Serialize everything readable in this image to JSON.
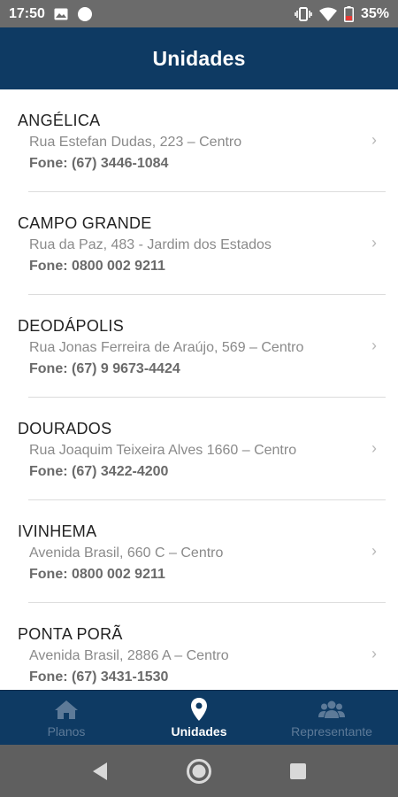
{
  "status_bar": {
    "time": "17:50",
    "battery": "35%",
    "icons": [
      "image-icon",
      "circle-notification-icon",
      "vibrate-icon",
      "wifi-icon",
      "battery-icon"
    ]
  },
  "header": {
    "title": "Unidades"
  },
  "units": [
    {
      "name": "ANGÉLICA",
      "address": "Rua Estefan Dudas, 223 – Centro",
      "phone": "Fone: (67) 3446-1084"
    },
    {
      "name": "CAMPO GRANDE",
      "address": "Rua da Paz, 483 - Jardim dos Estados",
      "phone": "Fone: 0800 002 9211"
    },
    {
      "name": "DEODÁPOLIS",
      "address": "Rua Jonas Ferreira de Araújo, 569 – Centro",
      "phone": "Fone: (67) 9 9673-4424"
    },
    {
      "name": "DOURADOS",
      "address": "Rua Joaquim Teixeira Alves 1660 – Centro",
      "phone": "Fone: (67) 3422-4200"
    },
    {
      "name": "IVINHEMA",
      "address": "Avenida Brasil, 660 C – Centro",
      "phone": "Fone: 0800 002 9211"
    },
    {
      "name": "PONTA PORÃ",
      "address": "Avenida Brasil, 2886 A – Centro",
      "phone": "Fone: (67) 3431-1530"
    }
  ],
  "chevron": "›",
  "bottom_nav": {
    "items": [
      {
        "label": "Planos",
        "icon": "home-icon",
        "active": false
      },
      {
        "label": "Unidades",
        "icon": "location-pin-icon",
        "active": true
      },
      {
        "label": "Representante",
        "icon": "people-icon",
        "active": false
      }
    ]
  },
  "colors": {
    "header_bg": "#0e3a63",
    "nav_active": "#ffffff",
    "nav_inactive": "#5d7a98",
    "status_bar_bg": "#6b6b6b",
    "battery_low": "#e53935"
  }
}
